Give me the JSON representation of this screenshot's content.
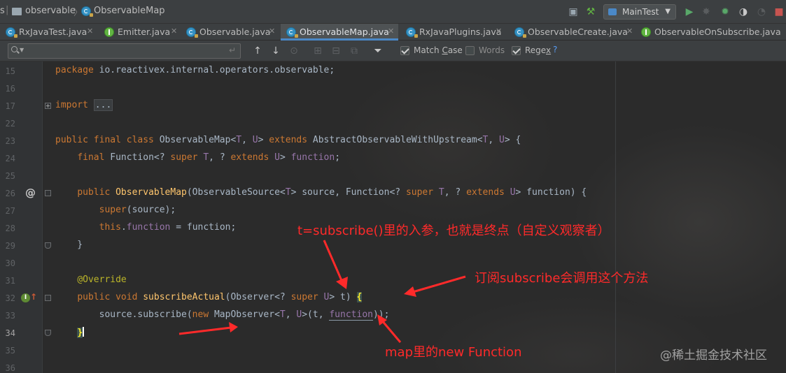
{
  "navbar": {
    "crumbs": [
      "s",
      "observable",
      "ObservableMap"
    ],
    "run_config": "MainTest"
  },
  "tabs": [
    {
      "label": "RxJavaTest.java",
      "icon": "class-icon"
    },
    {
      "label": "Emitter.java",
      "icon": "interface-icon"
    },
    {
      "label": "Observable.java",
      "icon": "class-icon"
    },
    {
      "label": "ObservableMap.java",
      "icon": "class-icon",
      "active": true
    },
    {
      "label": "RxJavaPlugins.java",
      "icon": "class-icon"
    },
    {
      "label": "ObservableCreate.java",
      "icon": "class-icon"
    },
    {
      "label": "ObservableOnSubscribe.java",
      "icon": "interface-icon"
    }
  ],
  "search": {
    "value": "",
    "match_case": {
      "label": "Match Case",
      "checked": true
    },
    "words": {
      "label": "Words",
      "checked": false
    },
    "regex": {
      "label": "Regex",
      "checked": true
    },
    "help": "?"
  },
  "lines": [
    {
      "n": "15"
    },
    {
      "n": "16"
    },
    {
      "n": "17"
    },
    {
      "n": "22"
    },
    {
      "n": "23"
    },
    {
      "n": "24"
    },
    {
      "n": "25"
    },
    {
      "n": "26"
    },
    {
      "n": "27"
    },
    {
      "n": "28"
    },
    {
      "n": "29"
    },
    {
      "n": "30"
    },
    {
      "n": "31"
    },
    {
      "n": "32"
    },
    {
      "n": "33"
    },
    {
      "n": "34"
    },
    {
      "n": "35"
    },
    {
      "n": "36"
    }
  ],
  "annotations": {
    "param_note": "t=subscribe()里的入参，也就是终点（自定义观察者）",
    "subscribe_note": "订阅subscribe会调用这个方法",
    "map_note": "map里的new Function"
  },
  "watermark": "@稀土掘金技术社区",
  "colors": {
    "keyword": "#cc7832",
    "type_param": "#9876aa",
    "method": "#ffc66d",
    "annotation": "#bbb529",
    "annotation_text": "#ff2a2a",
    "active_tab_accent": "#4a88c7"
  }
}
